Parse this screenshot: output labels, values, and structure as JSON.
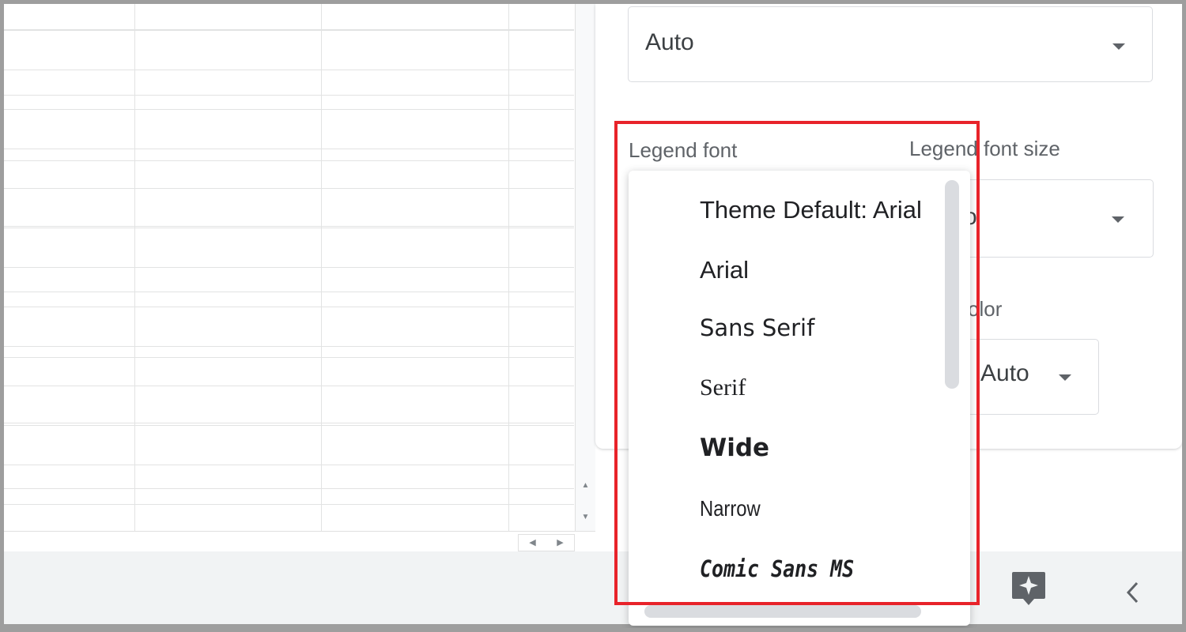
{
  "top_select": {
    "value": "Auto"
  },
  "legend_font": {
    "label": "Legend font",
    "options": [
      "Theme Default: Arial",
      "Arial",
      "Sans Serif",
      "Serif",
      "Wide",
      "Narrow",
      "Comic Sans MS"
    ]
  },
  "legend_font_size": {
    "label": "Legend font size",
    "value_partial": "o"
  },
  "legend_text_color": {
    "label_partial": "olor",
    "value": "Auto"
  },
  "colors": {
    "highlight": "#e8232a",
    "icon": "#5f6368"
  },
  "icons": {
    "explore": "explore-sparkle-icon",
    "collapse": "chevron-left-icon",
    "dropdown": "caret-down-icon"
  }
}
